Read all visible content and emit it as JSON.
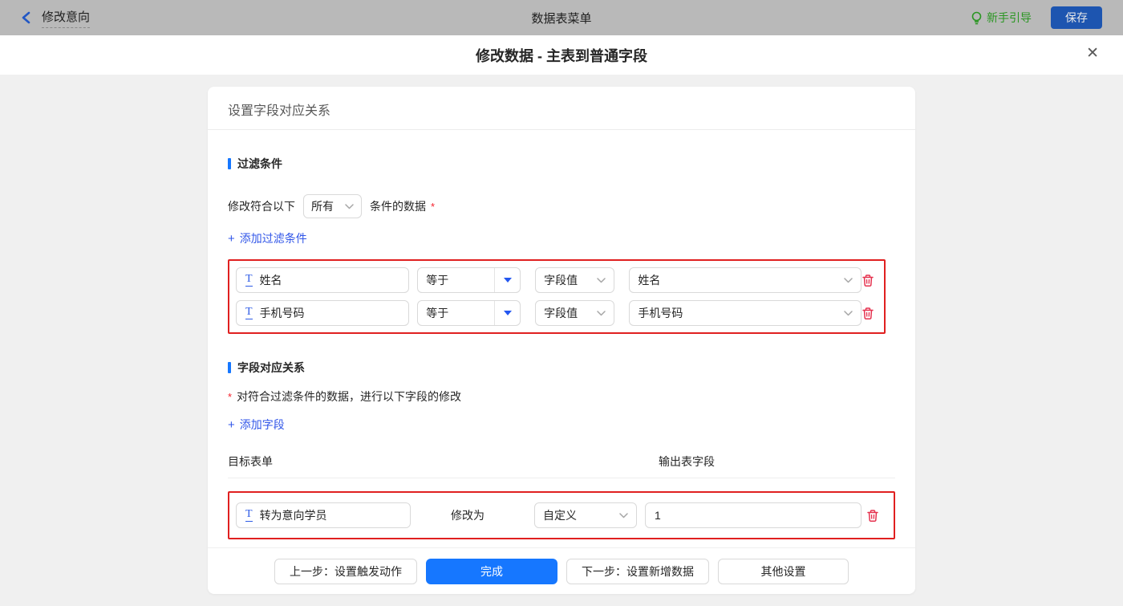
{
  "topbar": {
    "back_label": "修改意向",
    "title": "数据表菜单",
    "guide_label": "新手引导",
    "save_label": "保存"
  },
  "modal": {
    "title": "修改数据 - 主表到普通字段"
  },
  "card": {
    "header": "设置字段对应关系",
    "filter_section": {
      "title": "过滤条件",
      "match_prefix": "修改符合以下",
      "match_select_value": "所有",
      "match_suffix": "条件的数据",
      "required_mark": "*",
      "add_link_label": "添加过滤条件",
      "rows": [
        {
          "field": "姓名",
          "operator": "等于",
          "value_type": "字段值",
          "value": "姓名"
        },
        {
          "field": "手机号码",
          "operator": "等于",
          "value_type": "字段值",
          "value": "手机号码"
        }
      ]
    },
    "mapping_section": {
      "title": "字段对应关系",
      "required_mark": "*",
      "description": "对符合过滤条件的数据，进行以下字段的修改",
      "add_link_label": "添加字段",
      "col_target": "目标表单",
      "col_output": "输出表字段",
      "rows": [
        {
          "field": "转为意向学员",
          "action_label": "修改为",
          "value_type": "自定义",
          "value": "1"
        }
      ]
    }
  },
  "footer": {
    "prev_label": "上一步：设置触发动作",
    "done_label": "完成",
    "next_label": "下一步：设置新增数据",
    "other_label": "其他设置"
  },
  "icons": {
    "close": "✕",
    "plus": "+",
    "text_field": "T"
  },
  "colors": {
    "primary_blue": "#1677ff",
    "link_blue": "#3156e8",
    "alert_red_border": "#e02020",
    "danger_red": "#e5314e",
    "guide_green": "#2a9622",
    "save_button_blue": "#1d55b0",
    "topbar_gray": "#b9b9b9"
  }
}
